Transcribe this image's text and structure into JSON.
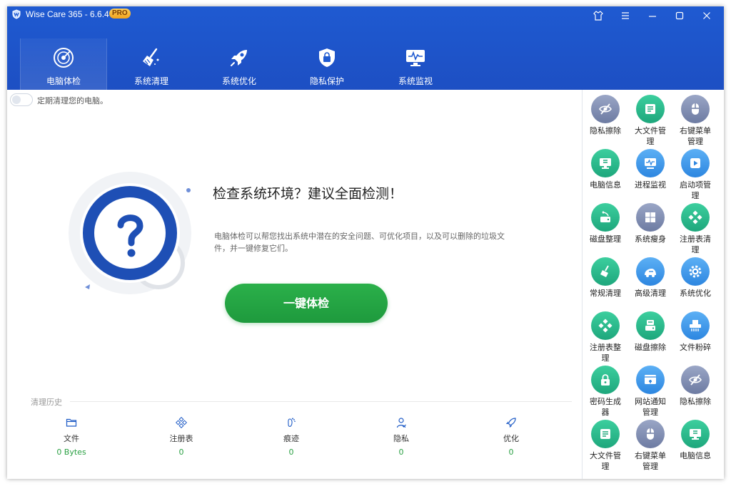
{
  "app": {
    "title": "Wise Care 365 - 6.6.4",
    "badge": "PRO"
  },
  "nav_tabs": [
    {
      "label": "电脑体检",
      "icon": "radar-icon"
    },
    {
      "label": "系统清理",
      "icon": "broom-icon"
    },
    {
      "label": "系统优化",
      "icon": "rocket-icon"
    },
    {
      "label": "隐私保护",
      "icon": "lock-shield-icon"
    },
    {
      "label": "系统监视",
      "icon": "monitor-icon"
    }
  ],
  "schedule": {
    "label": "定期清理您的电脑。",
    "enabled": false
  },
  "main": {
    "headline": "检查系统环境？建议全面检测！",
    "description": "电脑体检可以帮您找出系统中潜在的安全问题、可优化项目，以及可以删除的垃圾文件，并一键修复它们。",
    "scan_button": "一键体检"
  },
  "history": {
    "title": "清理历史",
    "items": [
      {
        "label": "文件",
        "value": "0 Bytes",
        "icon": "folder-icon"
      },
      {
        "label": "注册表",
        "value": "0",
        "icon": "registry-icon"
      },
      {
        "label": "痕迹",
        "value": "0",
        "icon": "footprint-icon"
      },
      {
        "label": "隐私",
        "value": "0",
        "icon": "user-privacy-icon"
      },
      {
        "label": "优化",
        "value": "0",
        "icon": "rocket-icon"
      }
    ]
  },
  "tools": [
    {
      "l1": "隐私擦除",
      "l2": "",
      "color": "slate",
      "icon": "eye-slash-icon"
    },
    {
      "l1": "大文件管",
      "l2": "理",
      "color": "green",
      "icon": "file-list-icon"
    },
    {
      "l1": "右键菜单",
      "l2": "管理",
      "color": "slate",
      "icon": "mouse-icon"
    },
    {
      "l1": "电脑信息",
      "l2": "",
      "color": "green",
      "icon": "computer-icon"
    },
    {
      "l1": "进程监视",
      "l2": "",
      "color": "blue",
      "icon": "process-monitor-icon"
    },
    {
      "l1": "启动项管",
      "l2": "理",
      "color": "blue",
      "icon": "startup-play-icon"
    },
    {
      "l1": "磁盘整理",
      "l2": "",
      "color": "green",
      "icon": "disk-defrag-icon"
    },
    {
      "l1": "系统瘦身",
      "l2": "",
      "color": "slate",
      "icon": "windows-icon"
    },
    {
      "l1": "注册表清",
      "l2": "理",
      "color": "green",
      "icon": "registry-clean-icon"
    },
    {
      "l1": "常规清理",
      "l2": "",
      "color": "green",
      "icon": "broom-icon"
    },
    {
      "l1": "高级清理",
      "l2": "",
      "color": "blue",
      "icon": "vacuum-icon"
    },
    {
      "l1": "系统优化",
      "l2": "",
      "color": "blue",
      "icon": "gear-icon"
    },
    {
      "l1": "注册表整",
      "l2": "理",
      "color": "green",
      "icon": "registry-defrag-icon"
    },
    {
      "l1": "磁盘擦除",
      "l2": "",
      "color": "green",
      "icon": "disk-wipe-icon"
    },
    {
      "l1": "文件粉碎",
      "l2": "",
      "color": "blue",
      "icon": "shredder-icon"
    },
    {
      "l1": "密码生成",
      "l2": "器",
      "color": "green",
      "icon": "password-lock-icon"
    },
    {
      "l1": "网站通知",
      "l2": "管理",
      "color": "blue",
      "icon": "browser-bell-icon"
    },
    {
      "l1": "隐私擦除",
      "l2": "",
      "color": "slate",
      "icon": "eye-slash-icon"
    },
    {
      "l1": "大文件管",
      "l2": "理",
      "color": "green",
      "icon": "file-list-icon"
    },
    {
      "l1": "右键菜单",
      "l2": "管理",
      "color": "slate",
      "icon": "mouse-icon"
    },
    {
      "l1": "电脑信息",
      "l2": "",
      "color": "green",
      "icon": "computer-icon"
    }
  ],
  "colors": {
    "header": "#1f5ad1",
    "scan_button": "#22a443",
    "accent_blue": "#1e4fb5",
    "badge": "#f5b02e"
  }
}
